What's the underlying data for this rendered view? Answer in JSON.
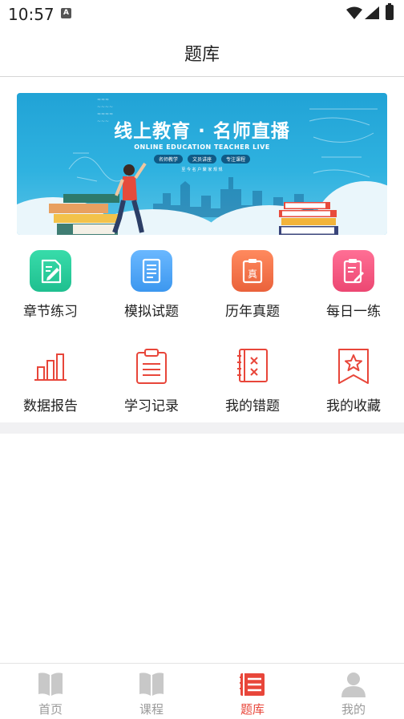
{
  "status_bar": {
    "time": "10:57",
    "notification_icon": "A"
  },
  "header": {
    "title": "题库"
  },
  "banner": {
    "title": "线上教育 · 名师直播",
    "subtitle": "ONLINE EDUCATION TEACHER LIVE",
    "tags": [
      "名师教学",
      "文员讲座",
      "专注课程"
    ],
    "tagline": "至 今 名 户 聚 家 规 规"
  },
  "features": [
    {
      "label": "章节练习",
      "icon": "chapter-practice-icon",
      "color": "#2fcf9c"
    },
    {
      "label": "模拟试题",
      "icon": "mock-exam-icon",
      "color": "#4aa7f5"
    },
    {
      "label": "历年真题",
      "icon": "past-exam-icon",
      "color": "#f0744a"
    },
    {
      "label": "每日一练",
      "icon": "daily-practice-icon",
      "color": "#f0537e"
    },
    {
      "label": "数据报告",
      "icon": "bar-chart-icon",
      "color": "#e8463a"
    },
    {
      "label": "学习记录",
      "icon": "clipboard-icon",
      "color": "#e8463a"
    },
    {
      "label": "我的错题",
      "icon": "wrong-questions-icon",
      "color": "#e8463a"
    },
    {
      "label": "我的收藏",
      "icon": "bookmark-star-icon",
      "color": "#e8463a"
    }
  ],
  "past_exam_badge": "真",
  "bottom_nav": [
    {
      "label": "首页",
      "icon": "book-icon",
      "active": false
    },
    {
      "label": "课程",
      "icon": "book-icon",
      "active": false
    },
    {
      "label": "题库",
      "icon": "question-bank-icon",
      "active": true
    },
    {
      "label": "我的",
      "icon": "user-icon",
      "active": false
    }
  ],
  "colors": {
    "accent": "#e8463a",
    "inactive": "#9a9a9a"
  }
}
